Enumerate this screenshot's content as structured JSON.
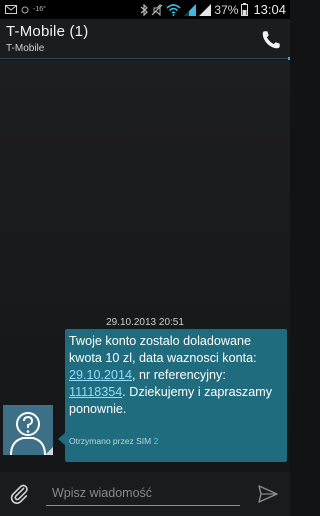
{
  "status_bar": {
    "temperature": "-16°",
    "battery_percent": "37%",
    "time": "13:04",
    "icons": [
      "mail-icon",
      "weather-icon",
      "bluetooth-icon",
      "mute-icon",
      "wifi-icon",
      "signal-icon",
      "battery-icon"
    ]
  },
  "header": {
    "title": "T-Mobile (1)",
    "subtitle": "T-Mobile",
    "call_icon": "phone-icon"
  },
  "conversation": {
    "date": "29.10.2013 20:51",
    "message": {
      "line1": "Twoje konto zostalo doladowane kwota 10 zl, data waznosci konta: ",
      "date_link": "29.10.2014",
      "line2": ", nr referencyjny: ",
      "ref_link": "11118354",
      "line3": ". Dziekujemy i zapraszamy ponownie.",
      "received_via": "Otrzymano przez SIM",
      "sim_number": "2"
    },
    "avatar_icon": "unknown-contact-icon"
  },
  "compose": {
    "placeholder": "Wpisz wiadomość",
    "attach_icon": "paperclip-icon",
    "send_icon": "send-icon"
  },
  "colors": {
    "bubble": "#1f6c7e",
    "accent": "#3aa7c6",
    "link": "#8fdcff",
    "avatar_bg": "#3d6f86"
  }
}
